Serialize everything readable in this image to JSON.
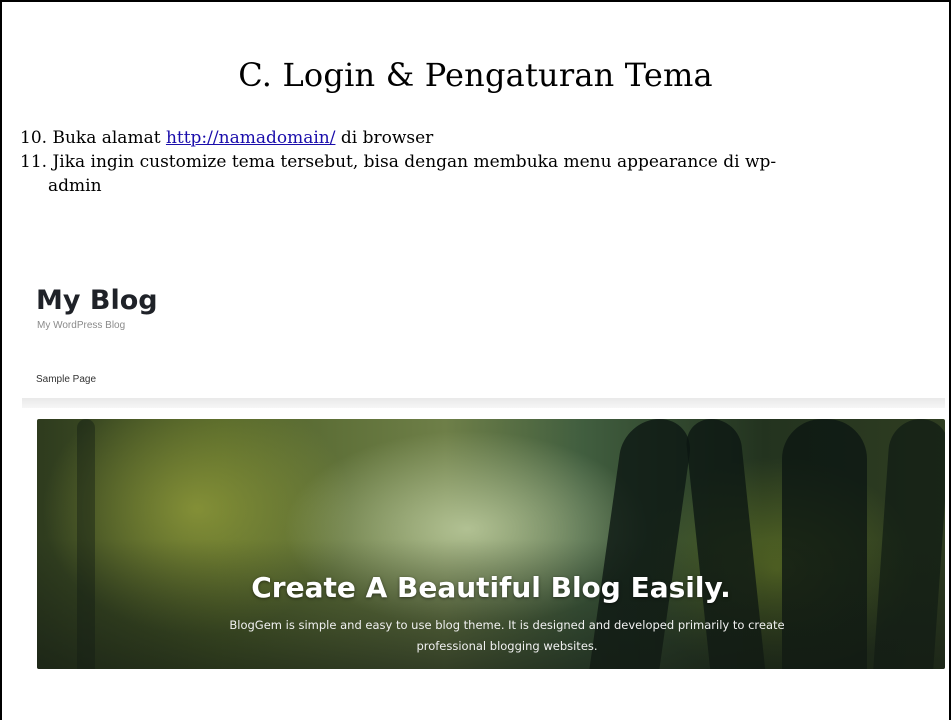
{
  "slide": {
    "title": "C. Login & Pengaturan Tema",
    "steps": [
      {
        "number": "10.",
        "before_link": "Buka alamat ",
        "link": "http://namadomain/",
        "after_link": " di browser"
      },
      {
        "number": "11.",
        "line1": "Jika ingin customize tema tersebut, bisa dengan membuka menu appearance  di wp-",
        "line2": "admin"
      }
    ]
  },
  "screenshot": {
    "site_title": "My Blog",
    "site_tagline": "My WordPress Blog",
    "nav": [
      "Sample Page"
    ],
    "hero": {
      "heading": "Create A Beautiful Blog Easily.",
      "subtext": "BlogGem is simple and easy to use blog theme. It is designed and developed primarily to create professional blogging websites."
    }
  }
}
